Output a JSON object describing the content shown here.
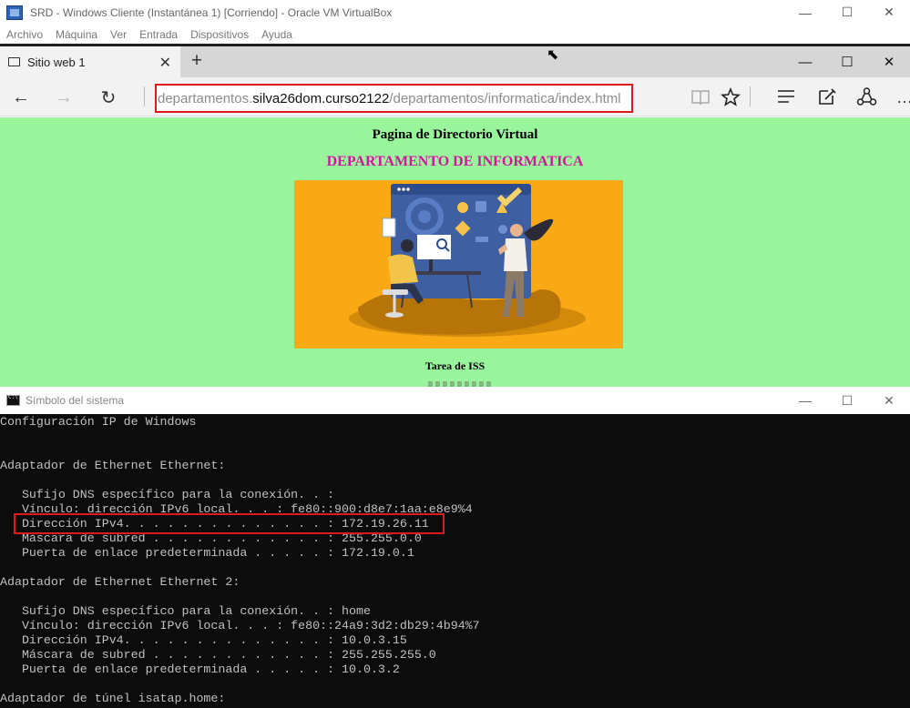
{
  "vbox": {
    "title": "SRD - Windows Cliente (Instantánea 1) [Corriendo] - Oracle VM VirtualBox",
    "menu": [
      "Archivo",
      "Máquina",
      "Ver",
      "Entrada",
      "Dispositivos",
      "Ayuda"
    ],
    "controls": {
      "minimize": "—",
      "maximize": "☐",
      "close": "✕"
    }
  },
  "browser": {
    "tab_title": "Sitio web 1",
    "tab_close": "✕",
    "new_tab": "+",
    "url": {
      "prefix": "departamentos.",
      "host": "silva26dom.curso2122",
      "path": "/departamentos/informatica/index.html"
    },
    "nav": {
      "back": "←",
      "forward": "→",
      "refresh": "↻"
    },
    "toolbar": {
      "reading_view": "📖",
      "favorite": "☆",
      "hub": "≡",
      "notes": "✎",
      "share": "⇪",
      "more": "…"
    }
  },
  "webpage": {
    "title": "Pagina de Directorio Virtual",
    "department": "DEPARTAMENTO DE INFORMATICA",
    "task": "Tarea de ISS"
  },
  "cmd": {
    "title": "Símbolo del sistema",
    "lines": [
      "Configuración IP de Windows",
      "",
      "",
      "Adaptador de Ethernet Ethernet:",
      "",
      "   Sufijo DNS específico para la conexión. . :",
      "   Vínculo: dirección IPv6 local. . . : fe80::900:d8e7:1aa:e8e9%4",
      "   Dirección IPv4. . . . . . . . . . . . . . : 172.19.26.11",
      "   Máscara de subred . . . . . . . . . . . . : 255.255.0.0",
      "   Puerta de enlace predeterminada . . . . . : 172.19.0.1",
      "",
      "Adaptador de Ethernet Ethernet 2:",
      "",
      "   Sufijo DNS específico para la conexión. . : home",
      "   Vínculo: dirección IPv6 local. . . : fe80::24a9:3d2:db29:4b94%7",
      "   Dirección IPv4. . . . . . . . . . . . . . : 10.0.3.15",
      "   Máscara de subred . . . . . . . . . . . . : 255.255.255.0",
      "   Puerta de enlace predeterminada . . . . . : 10.0.3.2",
      "",
      "Adaptador de túnel isatap.home:"
    ]
  },
  "colors": {
    "page_background": "#99f59b",
    "department_text": "#d1179e",
    "illustration_background": "#f9a913",
    "highlight": "#e0191b",
    "console_background": "#0c0c0c"
  }
}
